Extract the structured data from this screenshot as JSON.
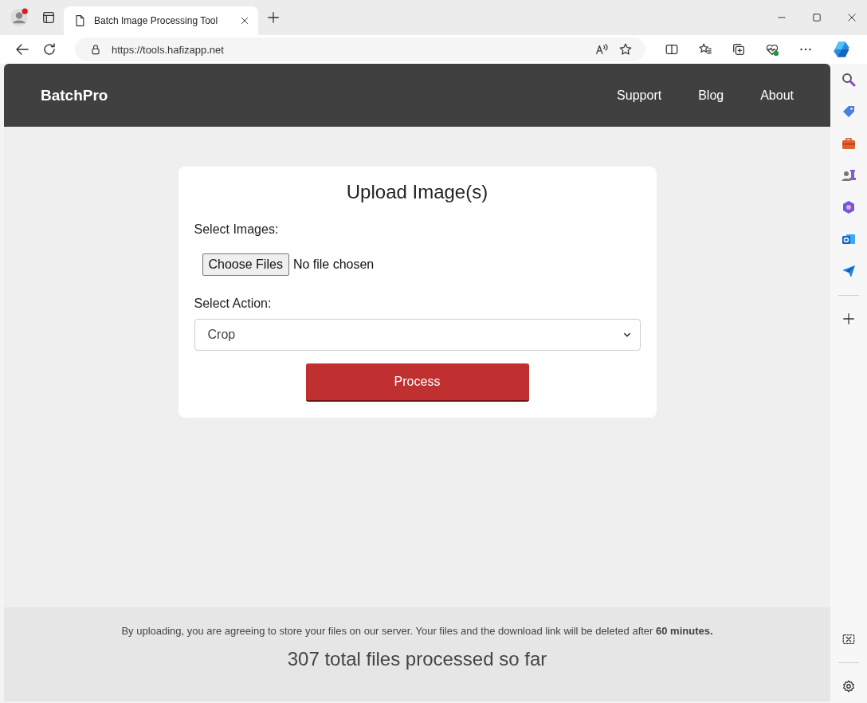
{
  "browser": {
    "tab_title": "Batch Image Processing Tool",
    "address": "https://tools.hafizapp.net"
  },
  "header": {
    "brand": "BatchPro",
    "nav": [
      {
        "label": "Support"
      },
      {
        "label": "Blog"
      },
      {
        "label": "About"
      }
    ]
  },
  "card": {
    "title": "Upload Image(s)",
    "images_label": "Select Images:",
    "file_button": "Choose Files",
    "file_status": "No file chosen",
    "action_label": "Select Action:",
    "action_value": "Crop",
    "submit": "Process"
  },
  "footer": {
    "notice": "By uploading, you are agreeing to store your files on our server. Your files and the download link will be deleted after **60 minutes.**",
    "counter": "307 total files processed so far"
  }
}
